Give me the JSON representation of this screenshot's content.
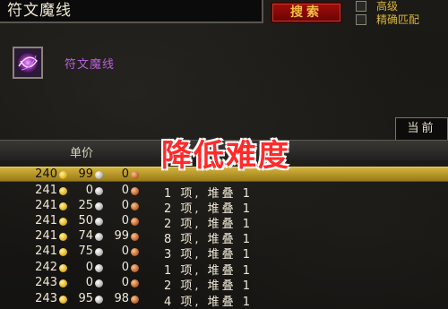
{
  "search": {
    "value": "符文魔线",
    "button_label": "搜索"
  },
  "filters": [
    {
      "label": "高级",
      "checked": false
    },
    {
      "label": "精确匹配",
      "checked": false
    }
  ],
  "item": {
    "name": "符文魔线",
    "icon": "runecloth-thread-icon"
  },
  "tabs": [
    {
      "label": "当前",
      "active": true
    }
  ],
  "header": {
    "unit_price_label": "单价"
  },
  "overlay_title": "降低难度",
  "rows": [
    {
      "gold": "240",
      "silver": "99",
      "copper": "0",
      "qty": "",
      "selected": true
    },
    {
      "gold": "241",
      "silver": "0",
      "copper": "0",
      "qty": "1 项, 堆叠 1",
      "selected": false
    },
    {
      "gold": "241",
      "silver": "25",
      "copper": "0",
      "qty": "2 项, 堆叠 1",
      "selected": false
    },
    {
      "gold": "241",
      "silver": "50",
      "copper": "0",
      "qty": "2 项, 堆叠 1",
      "selected": false
    },
    {
      "gold": "241",
      "silver": "74",
      "copper": "99",
      "qty": "8 项, 堆叠 1",
      "selected": false
    },
    {
      "gold": "241",
      "silver": "75",
      "copper": "0",
      "qty": "3 项, 堆叠 1",
      "selected": false
    },
    {
      "gold": "242",
      "silver": "0",
      "copper": "0",
      "qty": "1 项, 堆叠 1",
      "selected": false
    },
    {
      "gold": "243",
      "silver": "0",
      "copper": "0",
      "qty": "2 项, 堆叠 1",
      "selected": false
    },
    {
      "gold": "243",
      "silver": "95",
      "copper": "98",
      "qty": "4 项, 堆叠 1",
      "selected": false
    }
  ],
  "colors": {
    "item_quality": "#b760d8",
    "selection": "#d2b43c",
    "button": "#a10c0c",
    "overlay_text": "#ff2a2a"
  }
}
